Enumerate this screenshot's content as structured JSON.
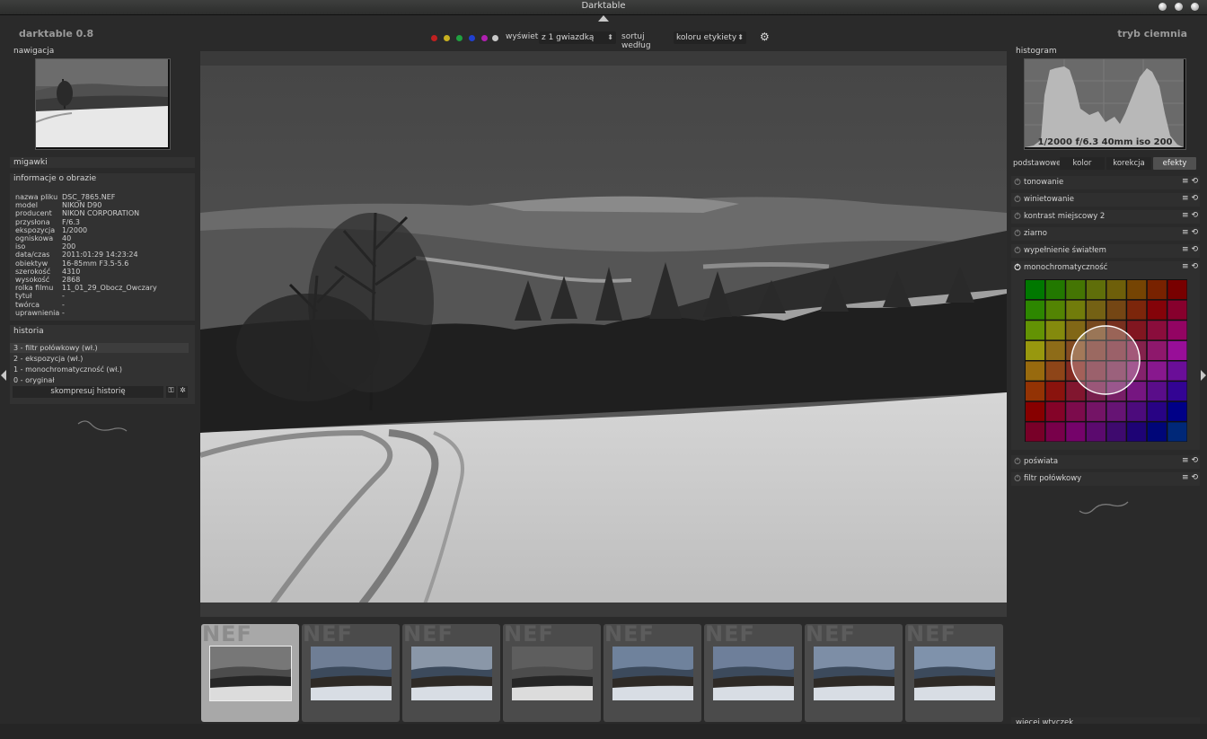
{
  "window": {
    "title": "Darktable"
  },
  "app": {
    "name": "darktable 0.8",
    "mode": "tryb ciemnia"
  },
  "topbar": {
    "color_labels": [
      "#c02020",
      "#c8b020",
      "#20a040",
      "#2040d0",
      "#b020b0",
      "#c8c8c8"
    ],
    "show_label": "wyświetl",
    "rating_filter": "z 1 gwiazdką",
    "sort_label": "sortuj według",
    "sort_value": "koloru etykiety",
    "settings_icon": "gear-icon"
  },
  "left": {
    "navigation_title": "nawigacja",
    "snapshots_title": "migawki",
    "image_info_title": "informacje o obrazie",
    "image_info": [
      {
        "key": "nazwa pliku",
        "value": "DSC_7865.NEF"
      },
      {
        "key": "model",
        "value": "NIKON D90"
      },
      {
        "key": "producent",
        "value": "NIKON CORPORATION"
      },
      {
        "key": "przysłona",
        "value": "F/6.3"
      },
      {
        "key": "ekspozycja",
        "value": "1/2000"
      },
      {
        "key": "ogniskowa",
        "value": "40"
      },
      {
        "key": "iso",
        "value": "200"
      },
      {
        "key": "data/czas",
        "value": "2011:01:29 14:23:24"
      },
      {
        "key": "obiektyw",
        "value": "16-85mm F3.5-5.6"
      },
      {
        "key": "szerokość",
        "value": "4310"
      },
      {
        "key": "wysokość",
        "value": "2868"
      },
      {
        "key": "rolka filmu",
        "value": "11_01_29_Obocz_Owczary"
      },
      {
        "key": "tytuł",
        "value": "-"
      },
      {
        "key": "twórca",
        "value": "-"
      },
      {
        "key": "uprawnienia",
        "value": "-"
      }
    ],
    "history_title": "historia",
    "history": [
      "3 - filtr połówkowy (wł.)",
      "2 - ekspozycja (wł.)",
      "1 - monochromatyczność (wł.)",
      "0 - oryginał"
    ],
    "compress_history": "skompresuj historię"
  },
  "right": {
    "histogram_title": "histogram",
    "histogram_info": "1/2000 f/6.3 40mm iso 200",
    "tabs": [
      "podstawowe",
      "kolor",
      "korekcja",
      "efekty"
    ],
    "active_tab": "efekty",
    "modules_top": [
      "tonowanie",
      "winietowanie",
      "kontrast miejscowy 2",
      "ziarno",
      "wypełnienie światłem"
    ],
    "expanded_module": "monochromatyczność",
    "modules_bottom": [
      "poświata",
      "filtr połówkowy"
    ],
    "more_plugins": "więcej wtyczek"
  },
  "filmstrip": {
    "badge": "NEF",
    "count": 8,
    "selected_index": 0
  }
}
